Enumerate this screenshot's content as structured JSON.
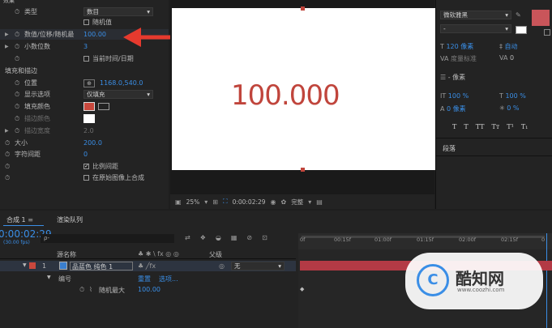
{
  "effects": {
    "header": "效果",
    "rows": [
      {
        "label": "类型",
        "dropdown": "数目"
      },
      {
        "label": "",
        "checkbox": "随机值",
        "checked": false
      },
      {
        "label": "数值/位移/随机最",
        "value": "100.00"
      },
      {
        "label": "小数位数",
        "value": "3"
      },
      {
        "label": "",
        "checkbox": "当前时间/日期",
        "checked": false
      },
      {
        "label": "填充和描边"
      },
      {
        "label": "位置",
        "value": "1168.0,540.0"
      },
      {
        "label": "显示选项",
        "dropdown": "仅填充"
      },
      {
        "label": "填充颜色"
      },
      {
        "label": "描边颜色"
      },
      {
        "label": "描边宽度",
        "value": "2.0"
      },
      {
        "label": "大小",
        "value": "200.0"
      },
      {
        "label": "字符间距",
        "value": "0"
      },
      {
        "label": "",
        "checkbox": "比例间距",
        "checked": true
      },
      {
        "label": "",
        "checkbox": "在原始图像上合成",
        "checked": false
      }
    ],
    "fill_color": "#c9483d"
  },
  "viewer": {
    "comp_text": "100.000",
    "zoom": "25%",
    "timecode": "0:00:02:29",
    "quality": "完整"
  },
  "character": {
    "font": "微软雅黑",
    "style": "-",
    "size": "120 像素",
    "leading": "自动",
    "kerning": "度量标准",
    "tracking": "0",
    "stroke": "- 像素",
    "vscale": "100 %",
    "hscale": "100 %",
    "baseline": "0 像素",
    "tsume": "0 %",
    "styles": [
      "T",
      "T",
      "TT",
      "Tт",
      "T¹",
      "T₁"
    ],
    "paragraph": "段落",
    "color": "#c9555a"
  },
  "timeline": {
    "tabs": [
      "合成 1",
      "渲染队列"
    ],
    "timecode": "0:00:02:29",
    "fps": "(30.00 fps)",
    "search_placeholder": "ρ-",
    "col_source": "源名称",
    "col_parent": "父级",
    "layer_num": "1",
    "layer_name": "品蓝色 纯色 1",
    "parent_value": "无",
    "sub_label": "编号",
    "sub_reset": "重置",
    "sub_options": "选项...",
    "prop_label": "随机最大",
    "prop_value": "100.00",
    "ticks": [
      "0f",
      "00:15f",
      "01:00f",
      "01:15f",
      "02:00f",
      "02:15f",
      "0"
    ]
  },
  "watermark": {
    "brand": "酷知网",
    "url": "www.coozhi.com"
  }
}
